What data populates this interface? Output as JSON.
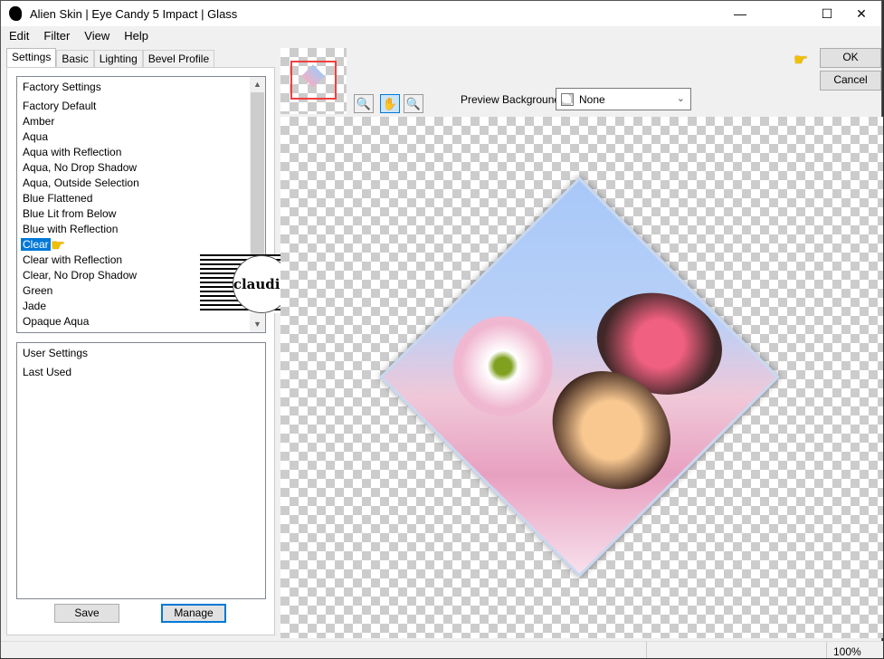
{
  "window": {
    "title": "Alien Skin | Eye Candy 5 Impact | Glass",
    "minimize": "—",
    "maximize": "☐",
    "close": "✕"
  },
  "menu": [
    "Edit",
    "Filter",
    "View",
    "Help"
  ],
  "tabs": [
    "Settings",
    "Basic",
    "Lighting",
    "Bevel Profile"
  ],
  "factory": {
    "header": "Factory Settings",
    "items": [
      "Factory Default",
      "Amber",
      "Aqua",
      "Aqua with Reflection",
      "Aqua, No Drop Shadow",
      "Aqua, Outside Selection",
      "Blue Flattened",
      "Blue Lit from Below",
      "Blue with Reflection",
      "Clear",
      "Clear with Reflection",
      "Clear, No Drop Shadow",
      "Green",
      "Jade",
      "Opaque Aqua"
    ],
    "selected": "Clear"
  },
  "user": {
    "header": "User Settings",
    "items": [
      "Last Used"
    ]
  },
  "buttons": {
    "save": "Save",
    "manage": "Manage",
    "ok": "OK",
    "cancel": "Cancel"
  },
  "preview_background": {
    "label": "Preview Background:",
    "value": "None"
  },
  "watermark": "claudia",
  "status": {
    "zoom": "100%"
  },
  "colors": {
    "selection": "#0078d7",
    "thumbnail_frame": "#f04040"
  }
}
